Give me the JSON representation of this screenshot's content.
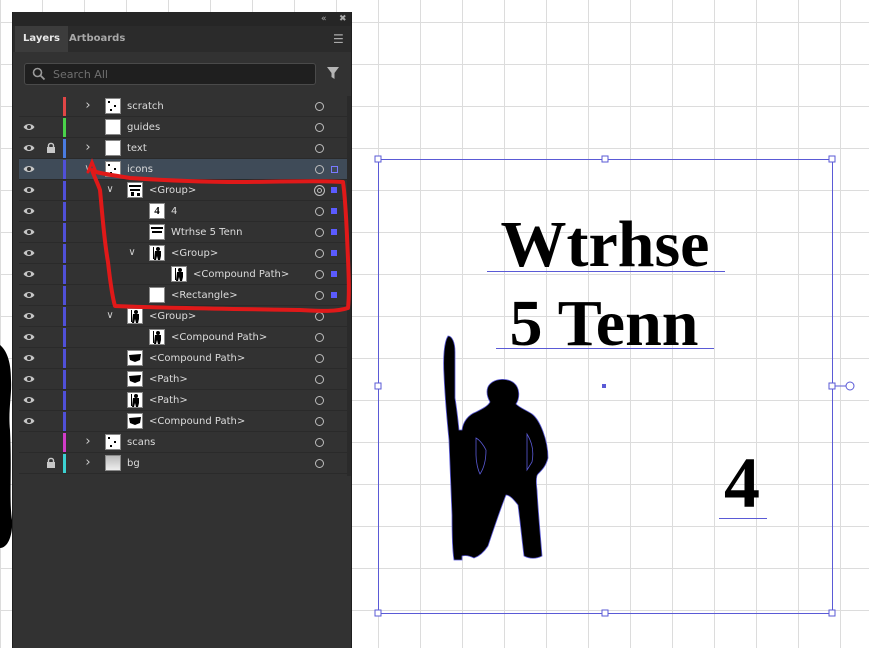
{
  "panel": {
    "tabs": [
      {
        "label": "Layers",
        "active": true
      },
      {
        "label": "Artboards",
        "active": false
      }
    ],
    "search": {
      "placeholder": "Search All"
    },
    "collapse_icon": "collapse-panel-icon",
    "close_icon": "close-icon",
    "menu_icon": "panel-menu-icon",
    "filter_icon": "filter-icon"
  },
  "layers": [
    {
      "name": "scratch",
      "visible": false,
      "locked": false,
      "color": "#e14646",
      "indent": 0,
      "expand": "collapsed",
      "target": "single",
      "selected": false,
      "thumb": "scratch"
    },
    {
      "name": "guides",
      "visible": true,
      "locked": false,
      "color": "#4ad24a",
      "indent": 0,
      "expand": "none",
      "target": "single",
      "selected": false,
      "thumb": "blank"
    },
    {
      "name": "text",
      "visible": true,
      "locked": true,
      "color": "#4a7ce1",
      "indent": 0,
      "expand": "collapsed",
      "target": "single",
      "selected": false,
      "thumb": "blank"
    },
    {
      "name": "icons",
      "visible": true,
      "locked": false,
      "color": "#5050d8",
      "indent": 0,
      "expand": "expanded",
      "target": "single",
      "selected": true,
      "thumb": "icons"
    },
    {
      "name": "<Group>",
      "visible": true,
      "locked": false,
      "color": "#5050d8",
      "indent": 1,
      "expand": "expanded",
      "target": "double",
      "selected": true,
      "thumb": "group"
    },
    {
      "name": "4",
      "visible": true,
      "locked": false,
      "color": "#5050d8",
      "indent": 2,
      "expand": "none",
      "target": "single",
      "selected": true,
      "thumb": "four"
    },
    {
      "name": "Wtrhse 5 Tenn",
      "visible": true,
      "locked": false,
      "color": "#5050d8",
      "indent": 2,
      "expand": "none",
      "target": "single",
      "selected": true,
      "thumb": "text"
    },
    {
      "name": "<Group>",
      "visible": true,
      "locked": false,
      "color": "#5050d8",
      "indent": 2,
      "expand": "expanded",
      "target": "single",
      "selected": true,
      "thumb": "figure"
    },
    {
      "name": "<Compound Path>",
      "visible": true,
      "locked": false,
      "color": "#5050d8",
      "indent": 3,
      "expand": "none",
      "target": "single",
      "selected": true,
      "thumb": "figure"
    },
    {
      "name": "<Rectangle>",
      "visible": true,
      "locked": false,
      "color": "#5050d8",
      "indent": 2,
      "expand": "none",
      "target": "single",
      "selected": true,
      "thumb": "blank"
    },
    {
      "name": "<Group>",
      "visible": true,
      "locked": false,
      "color": "#5050d8",
      "indent": 1,
      "expand": "expanded",
      "target": "single",
      "selected": false,
      "thumb": "figure"
    },
    {
      "name": "<Compound Path>",
      "visible": true,
      "locked": false,
      "color": "#5050d8",
      "indent": 2,
      "expand": "none",
      "target": "single",
      "selected": false,
      "thumb": "figure"
    },
    {
      "name": "<Compound Path>",
      "visible": true,
      "locked": false,
      "color": "#5050d8",
      "indent": 1,
      "expand": "none",
      "target": "single",
      "selected": false,
      "thumb": "shape"
    },
    {
      "name": "<Path>",
      "visible": true,
      "locked": false,
      "color": "#5050d8",
      "indent": 1,
      "expand": "none",
      "target": "single",
      "selected": false,
      "thumb": "shape"
    },
    {
      "name": "<Path>",
      "visible": true,
      "locked": false,
      "color": "#5050d8",
      "indent": 1,
      "expand": "none",
      "target": "single",
      "selected": false,
      "thumb": "figure"
    },
    {
      "name": "<Compound Path>",
      "visible": true,
      "locked": false,
      "color": "#5050d8",
      "indent": 1,
      "expand": "none",
      "target": "single",
      "selected": false,
      "thumb": "shape"
    },
    {
      "name": "scans",
      "visible": false,
      "locked": false,
      "color": "#d23cc8",
      "indent": 0,
      "expand": "collapsed",
      "target": "single",
      "selected": false,
      "thumb": "scratch"
    },
    {
      "name": "bg",
      "visible": false,
      "locked": true,
      "color": "#3cd2d2",
      "indent": 0,
      "expand": "collapsed",
      "target": "single",
      "selected": false,
      "thumb": "bg"
    }
  ],
  "artboard": {
    "line1": "Wtrhse",
    "line2": "5 Tenn",
    "number": "4",
    "selection_color": "#5a5ad6"
  }
}
